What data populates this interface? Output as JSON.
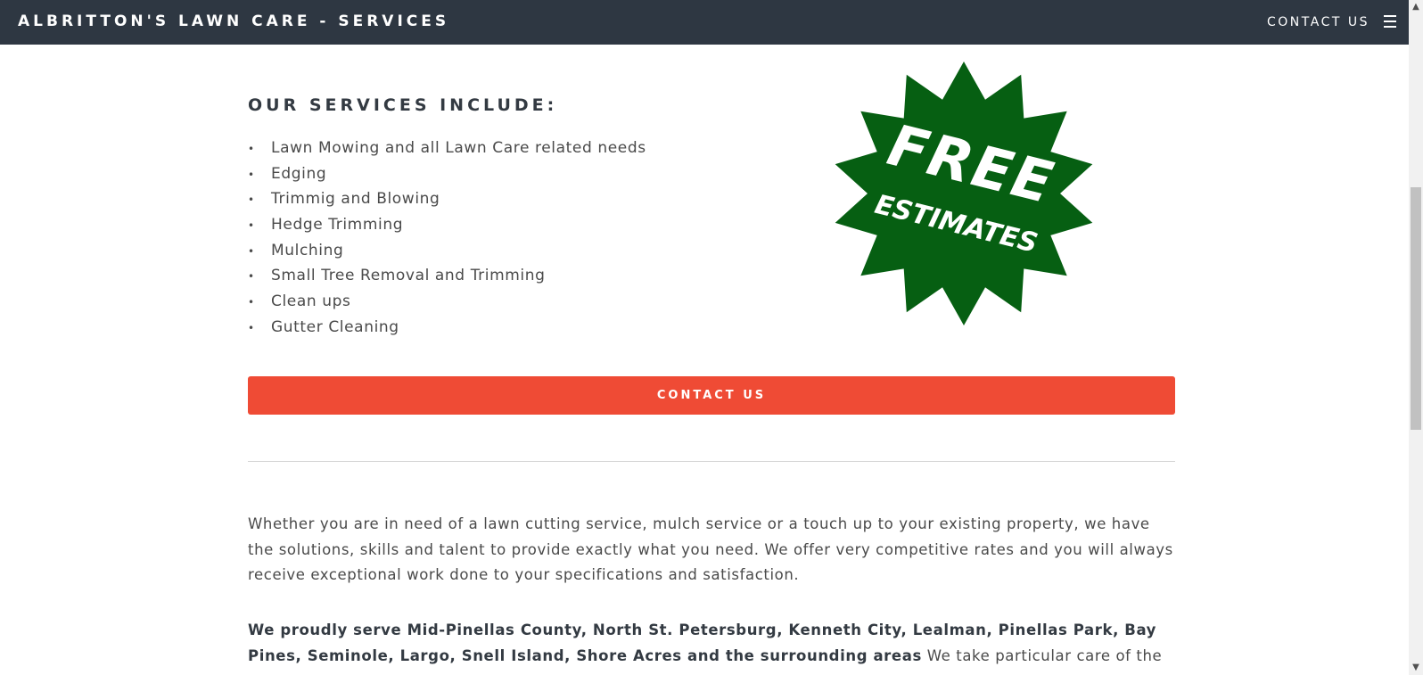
{
  "header": {
    "brand": "ALBRITTON'S LAWN CARE - SERVICES",
    "contact_label": "CONTACT US",
    "menu_icon": "hamburger-menu-icon"
  },
  "services": {
    "heading": "OUR SERVICES INCLUDE:",
    "bullet": "•",
    "items": [
      "Lawn Mowing and all Lawn Care related needs",
      "Edging",
      "Trimmig and Blowing",
      "Hedge Trimming",
      "Mulching",
      "Small Tree Removal and Trimming",
      "Clean ups",
      "Gutter Cleaning"
    ]
  },
  "badge": {
    "line1": "FREE",
    "line2": "ESTIMATES",
    "color": "#065f12",
    "text_color": "#ffffff"
  },
  "cta": {
    "label": "CONTACT US",
    "color": "#ef4b35"
  },
  "intro": {
    "text": "Whether you are in need of a lawn cutting service, mulch service or a touch up to your existing property, we have the solutions, skills and talent to provide exactly what you need. We offer very competitive rates and you will always receive exceptional work done to your specifications and satisfaction."
  },
  "service_area": {
    "bold": "We proudly serve Mid-Pinellas County,  North St. Petersburg, Kenneth City, Lealman, Pinellas Park, Bay Pines, Seminole, Largo, Snell Island, Shore Acres and the surrounding areas",
    "rest": " We take particular care of the"
  },
  "colors": {
    "nav_bg": "#2e3742",
    "accent": "#ef4b35",
    "badge_green": "#065f12"
  }
}
